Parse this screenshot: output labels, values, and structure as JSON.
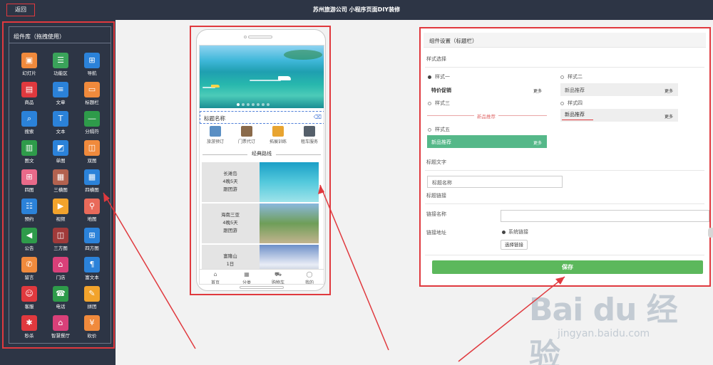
{
  "header": {
    "back_label": "返回",
    "title": "苏州旅游公司 小程序页面DIY装修"
  },
  "component_library": {
    "title": "组件库（拖拽使用）",
    "items": [
      {
        "label": "幻灯片",
        "icon": "slideshow-icon",
        "color": "#f08a3c"
      },
      {
        "label": "功能区",
        "icon": "feature-area-icon",
        "color": "#3aa35a"
      },
      {
        "label": "导航",
        "icon": "navigation-icon",
        "color": "#2b82d9"
      },
      {
        "label": "商品",
        "icon": "product-icon",
        "color": "#e0393e"
      },
      {
        "label": "文章",
        "icon": "article-icon",
        "color": "#2b82d9"
      },
      {
        "label": "标题栏",
        "icon": "title-bar-icon",
        "color": "#f08a3c"
      },
      {
        "label": "搜索",
        "icon": "search-icon",
        "color": "#2b82d9"
      },
      {
        "label": "文本",
        "icon": "text-icon",
        "color": "#2b82d9"
      },
      {
        "label": "分隔符",
        "icon": "divider-icon",
        "color": "#2e9b4a"
      },
      {
        "label": "图文",
        "icon": "image-text-icon",
        "color": "#2e9b4a"
      },
      {
        "label": "单图",
        "icon": "single-image-icon",
        "color": "#2b82d9"
      },
      {
        "label": "双图",
        "icon": "double-image-icon",
        "color": "#f08a3c"
      },
      {
        "label": "四图",
        "icon": "four-image-icon",
        "color": "#e96a8a"
      },
      {
        "label": "三横图",
        "icon": "three-horizontal-image-icon",
        "color": "#b2624f"
      },
      {
        "label": "四横图",
        "icon": "four-horizontal-image-icon",
        "color": "#2b82d9"
      },
      {
        "label": "预约",
        "icon": "reservation-icon",
        "color": "#2b82d9"
      },
      {
        "label": "视频",
        "icon": "video-icon",
        "color": "#f2a32c"
      },
      {
        "label": "地图",
        "icon": "map-icon",
        "color": "#e96a5a"
      },
      {
        "label": "公告",
        "icon": "announcement-icon",
        "color": "#2e9b4a"
      },
      {
        "label": "三方图",
        "icon": "three-square-image-icon",
        "color": "#a03a3a"
      },
      {
        "label": "四方图",
        "icon": "four-square-image-icon",
        "color": "#2b82d9"
      },
      {
        "label": "留言",
        "icon": "message-icon",
        "color": "#f08a3c"
      },
      {
        "label": "门店",
        "icon": "store-icon",
        "color": "#d94079"
      },
      {
        "label": "富文本",
        "icon": "rich-text-icon",
        "color": "#2b82d9"
      },
      {
        "label": "客服",
        "icon": "customer-service-icon",
        "color": "#e0393e"
      },
      {
        "label": "电话",
        "icon": "phone-icon",
        "color": "#2e9b4a"
      },
      {
        "label": "拼团",
        "icon": "group-buy-icon",
        "color": "#f2a32c"
      },
      {
        "label": "秒杀",
        "icon": "flash-sale-icon",
        "color": "#e0393e"
      },
      {
        "label": "智慧餐厅",
        "icon": "smart-restaurant-icon",
        "color": "#d94079"
      },
      {
        "label": "砍价",
        "icon": "bargain-icon",
        "color": "#f08a3c"
      }
    ]
  },
  "preview": {
    "title_bar_text": "标题名称",
    "nav_icons": [
      {
        "label": "旅游预订",
        "color": "#5a8fc4"
      },
      {
        "label": "门票代订",
        "color": "#8a6a4a"
      },
      {
        "label": "拓展训练",
        "color": "#e8a430"
      },
      {
        "label": "租车服务",
        "color": "#555f6a"
      }
    ],
    "section_title": "经典路线",
    "routes": [
      {
        "line1": "长滩岛",
        "line2": "4晚5天",
        "line3": "跟团游",
        "img_colors": [
          "#1b9fc7",
          "#54c9dc",
          "#9ee3ea"
        ]
      },
      {
        "line1": "海南三亚",
        "line2": "4晚5天",
        "line3": "跟团游",
        "img_colors": [
          "#8ab8de",
          "#6f9e58",
          "#c2b38f"
        ]
      },
      {
        "line1": "富隆山",
        "line2": "1日",
        "line3": "",
        "img_colors": [
          "#6d8fc8",
          "#e9edf6",
          "#7c8fa8"
        ]
      }
    ],
    "tabbar": [
      {
        "label": "首页",
        "icon": "home-icon",
        "glyph": "⌂"
      },
      {
        "label": "分类",
        "icon": "category-icon",
        "glyph": "▦"
      },
      {
        "label": "购物车",
        "icon": "cart-icon",
        "glyph": "⛟"
      },
      {
        "label": "我的",
        "icon": "user-icon",
        "glyph": "◯"
      }
    ]
  },
  "settings": {
    "header": "组件设置（标题栏）",
    "style_select_label": "样式选择",
    "styles": [
      {
        "label": "样式一",
        "selected": true,
        "sample_text": "特价促销",
        "sample_more": "更多"
      },
      {
        "label": "样式二",
        "selected": false,
        "sample_text": "新品推荐",
        "sample_more": "更多"
      },
      {
        "label": "样式三",
        "selected": false,
        "sample_text": "新品推荐"
      },
      {
        "label": "样式四",
        "selected": false,
        "sample_text": "新品推荐",
        "sample_more": "更多"
      },
      {
        "label": "样式五",
        "selected": false,
        "sample_text": "新品推荐",
        "sample_more": "更多"
      }
    ],
    "title_text_label": "标题文字",
    "title_text_value": "标题名称",
    "title_link_label": "标题链接",
    "link_name_label": "链接名称",
    "link_name_value": "",
    "link_address_label": "链接地址",
    "system_link_label": "系统链接",
    "select_link_label": "选择链接",
    "save_label": "保存"
  },
  "watermark": {
    "logo": "Bai du 经验",
    "url": "jingyan.baidu.com"
  },
  "colors": {
    "header_bg": "#2d3545",
    "accent_red": "#e0393e",
    "save_green": "#5cb85c",
    "style5_green": "#55b889"
  }
}
